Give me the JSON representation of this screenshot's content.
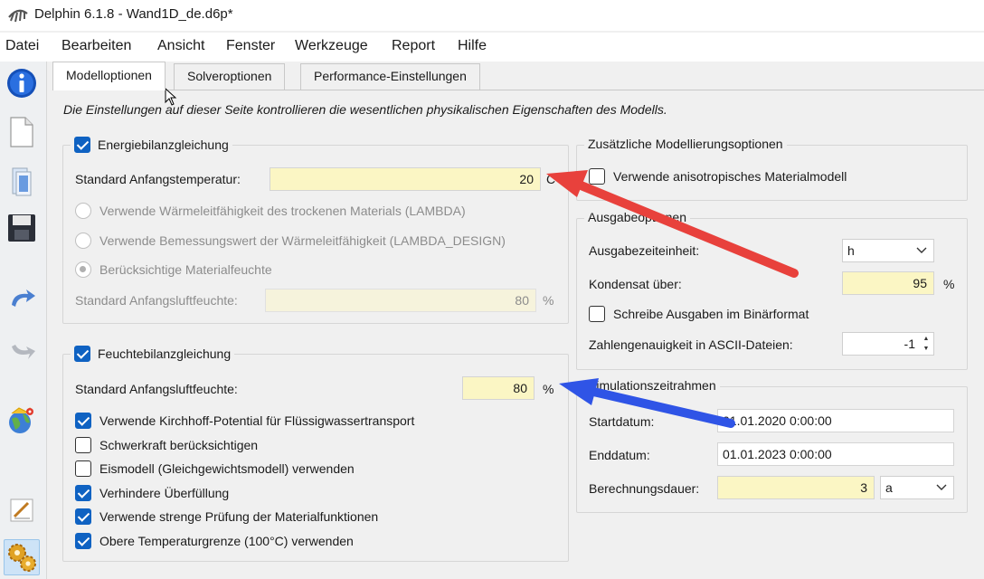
{
  "window": {
    "title": "Delphin 6.1.8 - Wand1D_de.d6p*"
  },
  "menu": [
    "Datei",
    "Bearbeiten",
    "Ansicht",
    "Fenster",
    "Werkzeuge",
    "Report",
    "Hilfe"
  ],
  "toolbar": {
    "icons": [
      "info-icon",
      "new-file-icon",
      "open-file-icon",
      "save-icon",
      "undo-icon",
      "redo-icon",
      "globe-location-icon",
      "edit-icon",
      "settings-gears-icon"
    ],
    "active": "settings-gears-icon"
  },
  "tabs": [
    "Modelloptionen",
    "Solveroptionen",
    "Performance-Einstellungen"
  ],
  "active_tab": "Modelloptionen",
  "intro": "Die Einstellungen auf dieser Seite kontrollieren die wesentlichen physikalischen Eigenschaften des Modells.",
  "energy": {
    "title": "Energiebilanzgleichung",
    "checked": true,
    "init_temp_label": "Standard Anfangstemperatur:",
    "init_temp_value": "20",
    "init_temp_unit": "C",
    "radio_lambda": "Verwende Wärmeleitfähigkeit des trockenen Materials (LAMBDA)",
    "radio_lambda_design": "Verwende Bemessungswert der Wärmeleitfähigkeit (LAMBDA_DESIGN)",
    "radio_moisture": "Berücksichtige Materialfeuchte",
    "init_rh_label": "Standard Anfangsluftfeuchte:",
    "init_rh_value": "80",
    "init_rh_unit": "%"
  },
  "moisture": {
    "title": "Feuchtebilanzgleichung",
    "checked": true,
    "init_rh_label": "Standard Anfangsluftfeuchte:",
    "init_rh_value": "80",
    "init_rh_unit": "%",
    "options": [
      {
        "label": "Verwende Kirchhoff-Potential für Flüssigwassertransport",
        "checked": true
      },
      {
        "label": "Schwerkraft berücksichtigen",
        "checked": false
      },
      {
        "label": "Eismodell (Gleichgewichtsmodell) verwenden",
        "checked": false
      },
      {
        "label": "Verhindere Überfüllung",
        "checked": true
      },
      {
        "label": "Verwende strenge Prüfung der Materialfunktionen",
        "checked": true
      },
      {
        "label": "Obere Temperaturgrenze (100°C) verwenden",
        "checked": true
      }
    ]
  },
  "additional": {
    "title": "Zusätzliche Modellierungsoptionen",
    "anisotropic_label": "Verwende anisotropisches Materialmodell",
    "anisotropic_checked": false
  },
  "output": {
    "title": "Ausgabeoptionen",
    "time_unit_label": "Ausgabezeiteinheit:",
    "time_unit_value": "h",
    "condensate_label": "Kondensat über:",
    "condensate_value": "95",
    "condensate_unit": "%",
    "binary_label": "Schreibe Ausgaben im Binärformat",
    "binary_checked": false,
    "precision_label": "Zahlengenauigkeit in ASCII-Dateien:",
    "precision_value": "-1"
  },
  "simulation": {
    "title": "Simulationszeitrahmen",
    "start_label": "Startdatum:",
    "start_value": "01.01.2020  0:00:00",
    "end_label": "Enddatum:",
    "end_value": "01.01.2023  0:00:00",
    "duration_label": "Berechnungsdauer:",
    "duration_value": "3",
    "duration_unit": "a"
  },
  "colors": {
    "highlight_field": "#fbf6c4",
    "checkbox_accent": "#0f62c2",
    "annotation_red": "#e8413c",
    "annotation_blue": "#2f54e6"
  }
}
